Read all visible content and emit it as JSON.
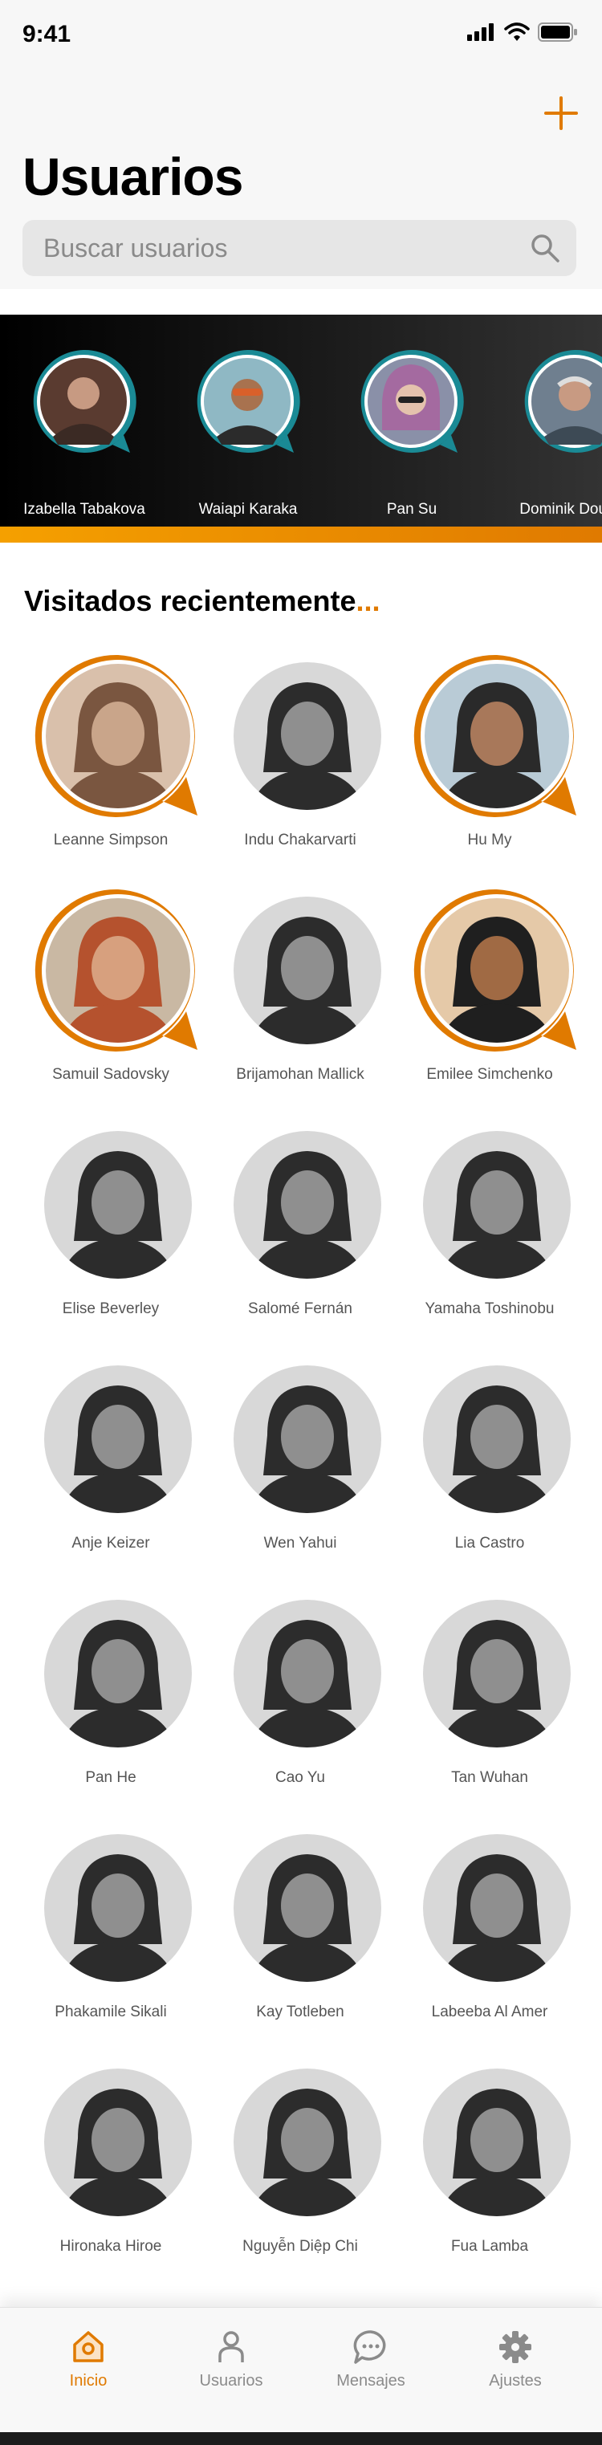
{
  "status_bar": {
    "time": "9:41"
  },
  "header": {
    "title": "Usuarios",
    "add_icon": "plus-icon"
  },
  "search": {
    "placeholder": "Buscar usuarios",
    "value": ""
  },
  "stories": [
    {
      "name": "Izabella Tabakova"
    },
    {
      "name": "Waiapi Karaka"
    },
    {
      "name": "Pan Su"
    },
    {
      "name": "Dominik Doudny"
    }
  ],
  "recent": {
    "title": "Visitados recientemente",
    "title_suffix": "...",
    "users": [
      {
        "name": "Leanne Simpson",
        "highlighted": true
      },
      {
        "name": "Indu Chakarvarti",
        "highlighted": false
      },
      {
        "name": "Hu My",
        "highlighted": true
      },
      {
        "name": "Samuil Sadovsky",
        "highlighted": true
      },
      {
        "name": "Brijamohan Mallick",
        "highlighted": false
      },
      {
        "name": "Emilee Simchenko",
        "highlighted": true
      },
      {
        "name": "Elise Beverley",
        "highlighted": false
      },
      {
        "name": "Salomé Fernán",
        "highlighted": false
      },
      {
        "name": "Yamaha Toshinobu",
        "highlighted": false
      },
      {
        "name": "Anje Keizer",
        "highlighted": false
      },
      {
        "name": "Wen Yahui",
        "highlighted": false
      },
      {
        "name": "Lia Castro",
        "highlighted": false
      },
      {
        "name": "Pan He",
        "highlighted": false
      },
      {
        "name": "Cao Yu",
        "highlighted": false
      },
      {
        "name": "Tan Wuhan",
        "highlighted": false
      },
      {
        "name": "Phakamile Sikali",
        "highlighted": false
      },
      {
        "name": "Kay Totleben",
        "highlighted": false
      },
      {
        "name": "Labeeba Al Amer",
        "highlighted": false
      },
      {
        "name": "Hironaka Hiroe",
        "highlighted": false
      },
      {
        "name": "Nguyễn Diệp Chi",
        "highlighted": false
      },
      {
        "name": "Fua Lamba",
        "highlighted": false
      }
    ]
  },
  "nav": [
    {
      "label": "Inicio",
      "icon": "home-icon",
      "active": true
    },
    {
      "label": "Usuarios",
      "icon": "user-icon",
      "active": false
    },
    {
      "label": "Mensajes",
      "icon": "chat-bubble-icon",
      "active": false
    },
    {
      "label": "Ajustes",
      "icon": "gear-icon",
      "active": false
    }
  ],
  "colors": {
    "accent": "#E07A00",
    "story_ring": "#1A8A95",
    "text_secondary": "#555555"
  }
}
